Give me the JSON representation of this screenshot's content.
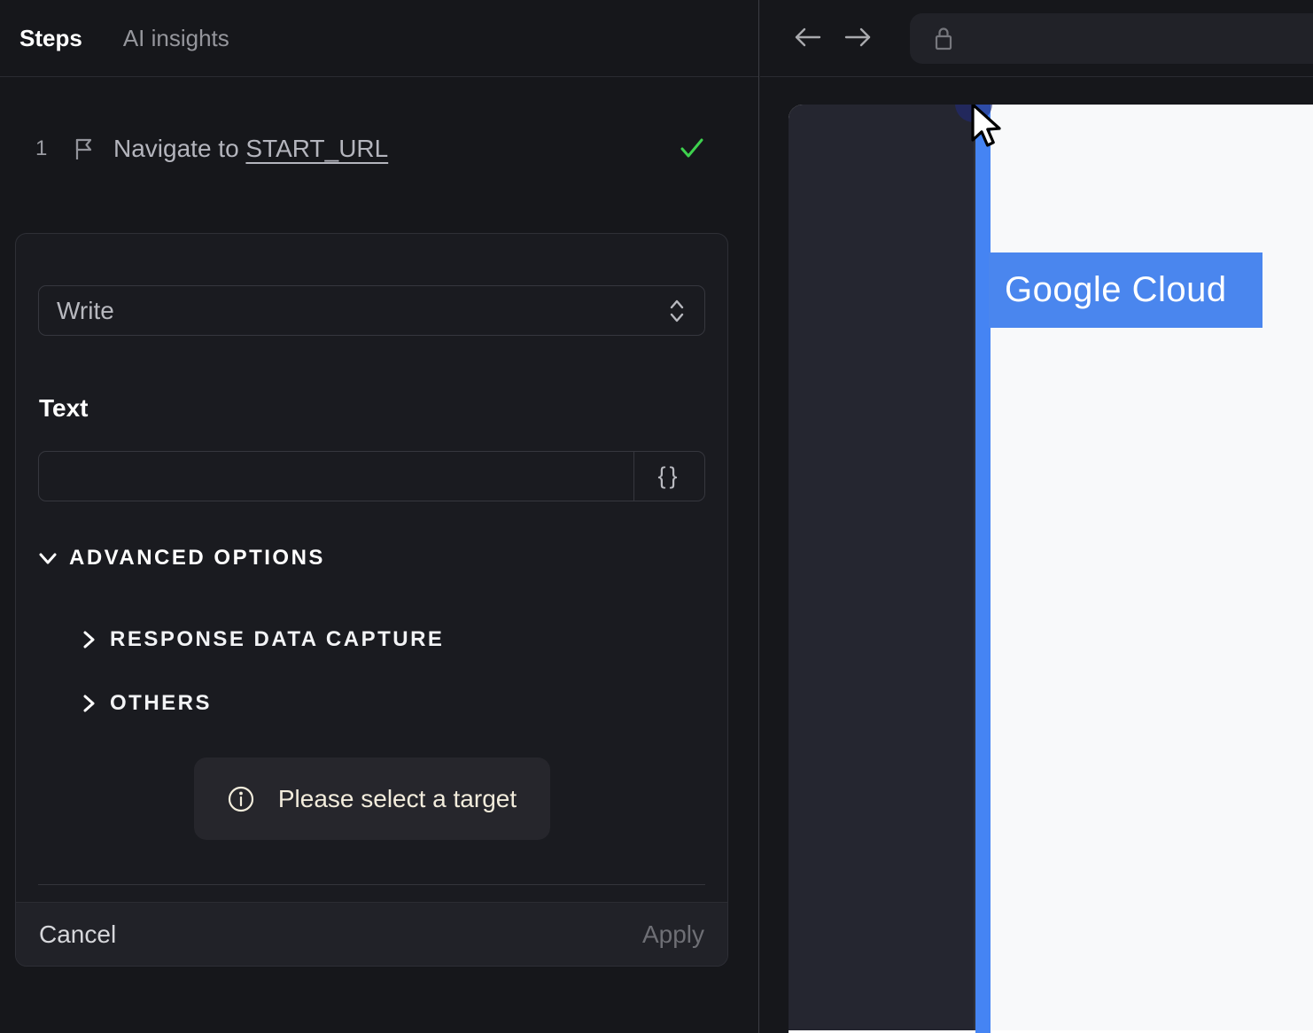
{
  "left_panel": {
    "tabs": [
      {
        "label": "Steps"
      },
      {
        "label": "AI insights"
      }
    ],
    "step": {
      "index": "1",
      "text": "Navigate to ",
      "link": "START_URL",
      "status": "success"
    },
    "editor": {
      "action_select": {
        "value": "Write"
      },
      "text_field": {
        "label": "Text",
        "value": "",
        "placeholder": ""
      },
      "variable_button_label": "{}",
      "advanced_options_label": "ADVANCED OPTIONS",
      "sections": [
        {
          "label": "RESPONSE DATA CAPTURE"
        },
        {
          "label": "OTHERS"
        }
      ],
      "notice": "Please select a target",
      "cancel_label": "Cancel",
      "apply_label": "Apply"
    }
  },
  "browser": {
    "url_value": "",
    "page": {
      "highlight_label": "Google Cloud"
    }
  },
  "colors": {
    "accent_blue": "#4a86ee",
    "highlight_strip_blue": "#4584f3",
    "success_green": "#3ed14e",
    "notice_cream": "#f2ecdc",
    "panel_bg": "#16171b",
    "page_content_bg": "#f8f9fa",
    "page_sidebar_bg": "#252630"
  }
}
